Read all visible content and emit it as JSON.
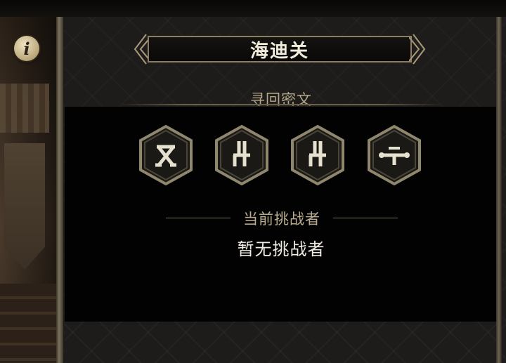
{
  "header": {
    "title": "海迪关",
    "info_icon": "info-icon",
    "info_glyph": "i"
  },
  "section": {
    "subtitle": "寻回密文"
  },
  "runes": [
    {
      "icon": "rune-x-glyph-icon"
    },
    {
      "icon": "rune-hook-glyph-icon"
    },
    {
      "icon": "rune-hook-glyph-icon"
    },
    {
      "icon": "rune-bar-glyph-icon"
    }
  ],
  "challenger": {
    "label": "当前挑战者",
    "value": "暂无挑战者"
  },
  "colors": {
    "panel": "#1d1c1a",
    "gold": "#8a7d62",
    "rune_stroke": "#9c9377",
    "rune_fill": "#e6e0cf",
    "text_light": "#f0ece2",
    "text_muted": "#b9ac8e"
  }
}
